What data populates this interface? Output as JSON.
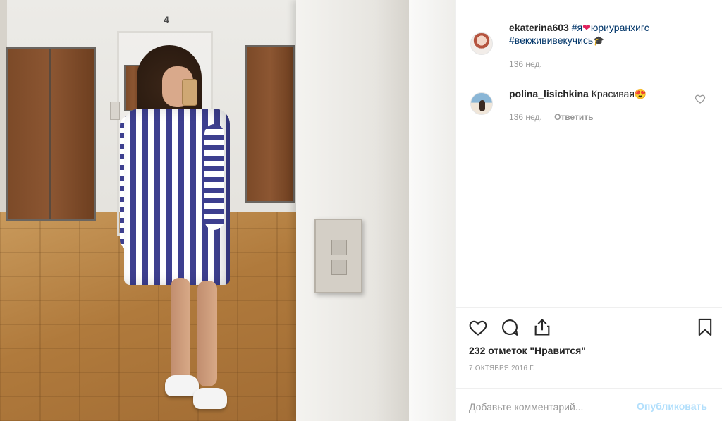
{
  "post": {
    "author": "ekaterina603",
    "caption_tag1": "#я",
    "caption_tag2": "юриуранхигс",
    "caption_tag3": "#векжививекучись",
    "time": "136 нед."
  },
  "comment": {
    "author": "polina_lisichkina",
    "text": "Красивая",
    "time": "136 нед.",
    "reply_label": "Ответить"
  },
  "likes_text": "232 отметок \"Нравится\"",
  "date": "7 ОКТЯБРЯ 2016 Г.",
  "wall_digit": "4",
  "add_comment": {
    "placeholder": "Добавьте комментарий...",
    "publish_label": "Опубликовать"
  },
  "colors": {
    "hashtag": "#003569",
    "publish_disabled": "#b2dffc",
    "muted": "#999999"
  },
  "icons": [
    "heart-icon",
    "comment-icon",
    "share-icon",
    "bookmark-icon",
    "small-heart-icon",
    "heart-emoji-icon",
    "heart-eyes-emoji-icon",
    "graduation-cap-emoji-icon"
  ]
}
